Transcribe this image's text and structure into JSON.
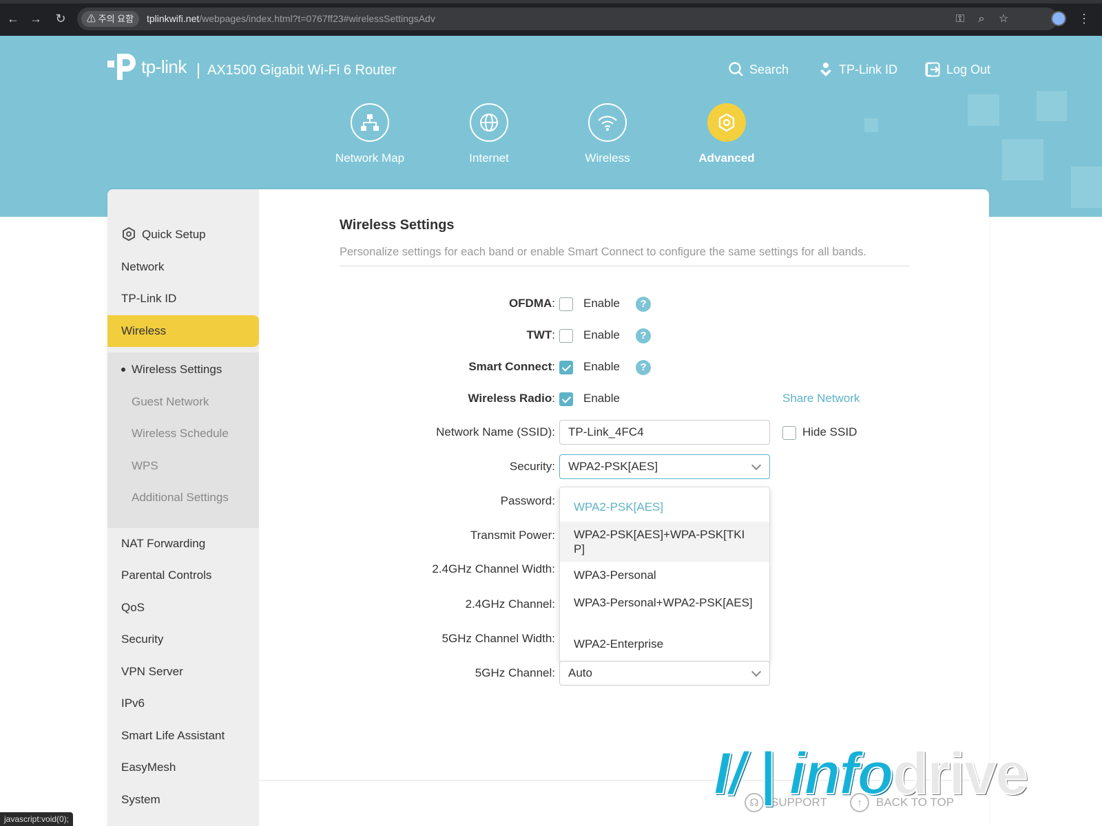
{
  "browser": {
    "warning_chip": "⚠ 주의 요함",
    "url_host": "tplinkwifi.net",
    "url_path": "/webpages/index.html?t=0767ff23#wirelessSettingsAdv",
    "status_tip": "javascript:void(0);"
  },
  "header": {
    "logo_text": "tp-link",
    "model": "AX1500 Gigabit Wi-Fi 6 Router",
    "links": [
      {
        "label": "Search",
        "icon": "search-icon"
      },
      {
        "label": "TP-Link ID",
        "icon": "tplink-id-icon"
      },
      {
        "label": "Log Out",
        "icon": "logout-icon"
      }
    ],
    "tabs": [
      {
        "label": "Network Map",
        "icon": "network-map-icon"
      },
      {
        "label": "Internet",
        "icon": "globe-icon"
      },
      {
        "label": "Wireless",
        "icon": "wifi-icon"
      },
      {
        "label": "Advanced",
        "icon": "gear-icon"
      }
    ],
    "active_tab": "Advanced",
    "accent_color": "#7ec4d6",
    "active_color": "#f2cd3e"
  },
  "sidebar": {
    "items": [
      {
        "label": "Quick Setup",
        "icon": "gear-icon"
      },
      {
        "label": "Network"
      },
      {
        "label": "TP-Link ID"
      },
      {
        "label": "Wireless"
      },
      {
        "label": "NAT Forwarding"
      },
      {
        "label": "Parental Controls"
      },
      {
        "label": "QoS"
      },
      {
        "label": "Security"
      },
      {
        "label": "VPN Server"
      },
      {
        "label": "IPv6"
      },
      {
        "label": "Smart Life Assistant"
      },
      {
        "label": "EasyMesh"
      },
      {
        "label": "System"
      }
    ],
    "active": "Wireless",
    "sub_items": [
      {
        "label": "Wireless Settings"
      },
      {
        "label": "Guest Network"
      },
      {
        "label": "Wireless Schedule"
      },
      {
        "label": "WPS"
      },
      {
        "label": "Additional Settings"
      }
    ],
    "active_sub": "Wireless Settings"
  },
  "content": {
    "title": "Wireless Settings",
    "description": "Personalize settings for each band or enable Smart Connect to configure the same settings for all bands.",
    "colon": ":",
    "ofdma": {
      "label": "OFDMA",
      "option": "Enable",
      "checked": false
    },
    "twt": {
      "label": "TWT",
      "option": "Enable",
      "checked": false
    },
    "smart_connect": {
      "label": "Smart Connect",
      "option": "Enable",
      "checked": true
    },
    "wireless_radio": {
      "label": "Wireless Radio",
      "option": "Enable",
      "checked": true
    },
    "share_network": "Share Network",
    "ssid": {
      "label": "Network Name (SSID):",
      "value": "TP-Link_4FC4"
    },
    "hide_ssid": {
      "label": "Hide SSID",
      "checked": false
    },
    "security": {
      "label": "Security:",
      "value": "WPA2-PSK[AES]",
      "options": [
        "WPA2-PSK[AES]",
        "WPA2-PSK[AES]+WPA-PSK[TKIP]",
        "WPA3-Personal",
        "WPA3-Personal+WPA2-PSK[AES]",
        "WPA2-Enterprise"
      ]
    },
    "password_label": "Password:",
    "transmit_power_label": "Transmit Power:",
    "ch_width_24_label": "2.4GHz Channel Width:",
    "channel_24_label": "2.4GHz Channel:",
    "ch_width_5_label": "5GHz Channel Width:",
    "channel_5": {
      "label": "5GHz Channel:",
      "value": "Auto"
    }
  },
  "footer": {
    "support": "SUPPORT",
    "back_to_top": "BACK TO TOP"
  },
  "watermark": {
    "mark": "I/",
    "bar": "|",
    "info": "info",
    "drive": "drive"
  }
}
